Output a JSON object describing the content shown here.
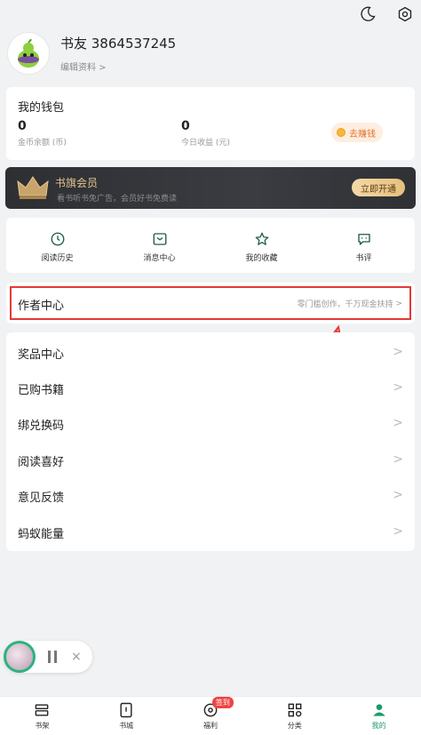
{
  "profile": {
    "name": "书友 3864537245",
    "edit_label": "编辑资料 >"
  },
  "wallet": {
    "title": "我的钱包",
    "coins_value": "0",
    "coins_label": "金币余额 (币)",
    "today_value": "0",
    "today_label": "今日收益 (元)",
    "earn_label": "去赚钱"
  },
  "vip": {
    "title": "书旗会员",
    "subtitle": "看书听书免广告，会员好书免费读",
    "button": "立即开通"
  },
  "quick": [
    {
      "label": "阅读历史",
      "icon": "clock-icon"
    },
    {
      "label": "消息中心",
      "icon": "inbox-icon"
    },
    {
      "label": "我的收藏",
      "icon": "star-icon"
    },
    {
      "label": "书评",
      "icon": "chat-icon"
    }
  ],
  "author": {
    "title": "作者中心",
    "subtitle": "零门槛创作，千万现金扶持",
    "chevron": ">"
  },
  "menu": [
    {
      "label": "奖品中心"
    },
    {
      "label": "已购书籍"
    },
    {
      "label": "绑兑换码"
    },
    {
      "label": "阅读喜好"
    },
    {
      "label": "意见反馈"
    },
    {
      "label": "蚂蚁能量"
    }
  ],
  "chevron": ">",
  "player": {
    "close": "×"
  },
  "tabs": [
    {
      "label": "书架",
      "icon": "bookshelf-icon"
    },
    {
      "label": "书城",
      "icon": "bookstore-icon"
    },
    {
      "label": "福利",
      "icon": "welfare-icon",
      "badge": "签到"
    },
    {
      "label": "分类",
      "icon": "category-icon"
    },
    {
      "label": "我的",
      "icon": "profile-icon",
      "active": true
    }
  ],
  "colors": {
    "accent": "#1a9b6a",
    "highlight": "#e53935",
    "vip_gold": "#e6c58e"
  }
}
